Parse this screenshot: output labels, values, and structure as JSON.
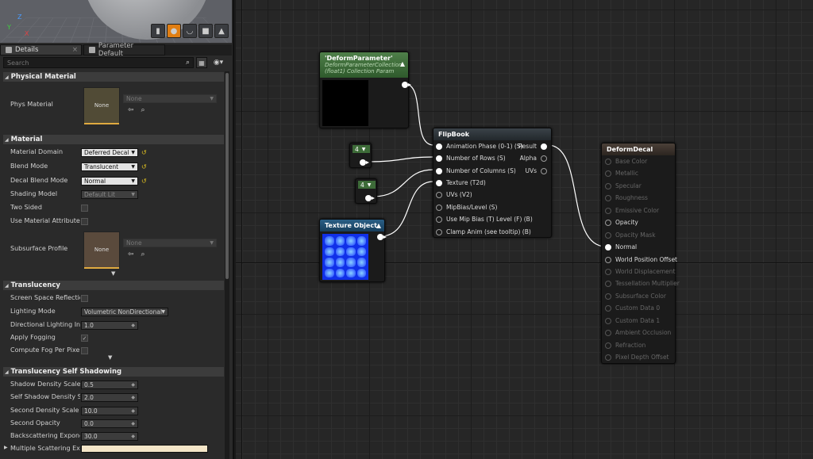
{
  "viewport": {
    "axis_z": "Z",
    "axis_y": "Y",
    "axis_x": "X"
  },
  "tabs": [
    {
      "label": "Details"
    },
    {
      "label": "Parameter Default"
    }
  ],
  "search": {
    "placeholder": "Search",
    "value": ""
  },
  "sections": {
    "physical_material": "Physical Material",
    "material": "Material",
    "translucency": "Translucency",
    "self_shadow": "Translucency Self Shadowing"
  },
  "props": {
    "phys_material": {
      "label": "Phys Material",
      "thumb": "None",
      "value": "None"
    },
    "material_domain": {
      "label": "Material Domain",
      "value": "Deferred Decal"
    },
    "blend_mode": {
      "label": "Blend Mode",
      "value": "Translucent"
    },
    "decal_blend_mode": {
      "label": "Decal Blend Mode",
      "value": "Normal"
    },
    "shading_model": {
      "label": "Shading Model",
      "value": "Default Lit"
    },
    "two_sided": {
      "label": "Two Sided"
    },
    "use_material_attributes": {
      "label": "Use Material Attributes"
    },
    "subsurface_profile": {
      "label": "Subsurface Profile",
      "thumb": "None",
      "value": "None"
    },
    "ssr": {
      "label": "Screen Space Reflections"
    },
    "lighting_mode": {
      "label": "Lighting Mode",
      "value": "Volumetric NonDirectional"
    },
    "directional_lighting": {
      "label": "Directional Lighting Intensity",
      "value": "1.0"
    },
    "apply_fogging": {
      "label": "Apply Fogging"
    },
    "compute_fog": {
      "label": "Compute Fog Per Pixel"
    },
    "shadow_density": {
      "label": "Shadow Density Scale",
      "value": "0.5"
    },
    "self_shadow_density": {
      "label": "Self Shadow Density Scale",
      "value": "2.0"
    },
    "second_density": {
      "label": "Second Density Scale",
      "value": "10.0"
    },
    "second_opacity": {
      "label": "Second Opacity",
      "value": "0.0"
    },
    "backscattering": {
      "label": "Backscattering Exponent",
      "value": "30.0"
    },
    "multiple_scattering": {
      "label": "Multiple Scattering Extinction"
    }
  },
  "nodes": {
    "deform_param": {
      "title": "'DeformParameter'",
      "sub1": "DeformParameterCollection",
      "sub2": "(float1) Collection Param"
    },
    "const_rows": {
      "value": "4"
    },
    "const_cols": {
      "value": "4"
    },
    "texture_object": {
      "title": "Texture Object"
    },
    "flipbook": {
      "title": "FlipBook",
      "inputs": [
        "Animation  Phase (0-1) (S)",
        "Number of Rows (S)",
        "Number of Columns (S)",
        "Texture (T2d)",
        "UVs (V2)",
        "MipBias/Level (S)",
        "Use Mip Bias (T) Level (F) (B)",
        "Clamp Anim (see tooltip) (B)"
      ],
      "outputs": [
        "Result",
        "Alpha",
        "UVs"
      ]
    },
    "deform_decal": {
      "title": "DeformDecal",
      "pins": [
        "Base Color",
        "Metallic",
        "Specular",
        "Roughness",
        "Emissive Color",
        "Opacity",
        "Opacity Mask",
        "Normal",
        "World Position Offset",
        "World Displacement",
        "Tessellation Multiplier",
        "Subsurface Color",
        "Custom Data 0",
        "Custom Data 1",
        "Ambient Occlusion",
        "Refraction",
        "Pixel Depth Offset"
      ]
    }
  },
  "colors": {
    "accent": "#e07e13",
    "param_header": "#3d6b38",
    "tex_header": "#1d4a6a",
    "func_header": "#2b3136",
    "result_header": "#3a322a",
    "swatch": "#f5e6c8"
  }
}
